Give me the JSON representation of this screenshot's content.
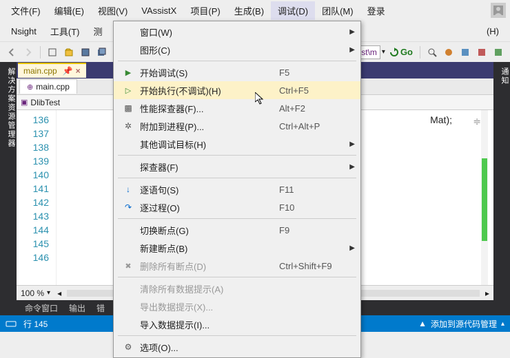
{
  "menubar": {
    "row1": [
      "文件(F)",
      "编辑(E)",
      "视图(V)",
      "VAssistX",
      "项目(P)",
      "生成(B)",
      "调试(D)",
      "团队(M)",
      "登录"
    ],
    "row2": [
      "Nsight",
      "工具(T)",
      "测"
    ],
    "row2_extra": "(H)",
    "active_index": 6
  },
  "dropdown": {
    "items": [
      {
        "label": "窗口(W)",
        "shortcut": "",
        "submenu": true
      },
      {
        "label": "图形(C)",
        "shortcut": "",
        "submenu": true
      },
      {
        "sep": true
      },
      {
        "icon": "play",
        "label": "开始调试(S)",
        "shortcut": "F5"
      },
      {
        "icon": "play-outline",
        "label": "开始执行(不调试)(H)",
        "shortcut": "Ctrl+F5",
        "hover": true
      },
      {
        "icon": "perf",
        "label": "性能探查器(F)...",
        "shortcut": "Alt+F2"
      },
      {
        "icon": "attach",
        "label": "附加到进程(P)...",
        "shortcut": "Ctrl+Alt+P"
      },
      {
        "label": "其他调试目标(H)",
        "shortcut": "",
        "submenu": true
      },
      {
        "sep": true
      },
      {
        "label": "探查器(F)",
        "shortcut": "",
        "submenu": true
      },
      {
        "sep": true
      },
      {
        "icon": "step-into",
        "label": "逐语句(S)",
        "shortcut": "F11"
      },
      {
        "icon": "step-over",
        "label": "逐过程(O)",
        "shortcut": "F10"
      },
      {
        "sep": true
      },
      {
        "label": "切换断点(G)",
        "shortcut": "F9"
      },
      {
        "label": "新建断点(B)",
        "shortcut": "",
        "submenu": true
      },
      {
        "icon": "delete-bp",
        "label": "删除所有断点(D)",
        "shortcut": "Ctrl+Shift+F9",
        "disabled": true
      },
      {
        "sep": true
      },
      {
        "label": "清除所有数据提示(A)",
        "shortcut": "",
        "disabled": true
      },
      {
        "label": "导出数据提示(X)...",
        "shortcut": "",
        "disabled": true
      },
      {
        "label": "导入数据提示(I)...",
        "shortcut": ""
      },
      {
        "sep": true
      },
      {
        "icon": "gear",
        "label": "选项(O)...",
        "shortcut": ""
      }
    ]
  },
  "tabs": {
    "main_tab": "main.cpp",
    "sub_tab": "main.cpp",
    "project_tab": "DlibTest"
  },
  "address_bar": {
    "path": "est\\DlibTest\\m",
    "go": "Go"
  },
  "code": {
    "line_numbers": [
      "136",
      "137",
      "138",
      "139",
      "140",
      "141",
      "142",
      "143",
      "144",
      "145",
      "146"
    ],
    "visible_fragment": "Mat);"
  },
  "zoom": "100 %",
  "bottom_tabs": [
    "命令窗口",
    "输出",
    "错"
  ],
  "status": {
    "line": "行 145",
    "right": "添加到源代码管理",
    "arrow": "▲"
  },
  "sidebar_left": "解决方案资源管理器",
  "sidebar_right": "通知",
  "icons": {
    "drive": "▭",
    "user": "◩"
  }
}
